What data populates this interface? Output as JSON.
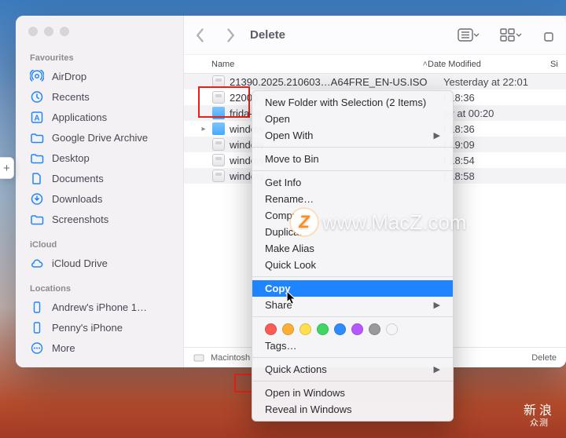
{
  "window_title": "Delete",
  "sidebar": {
    "groups": [
      {
        "header": "Favourites",
        "items": [
          {
            "name": "airdrop",
            "label": "AirDrop",
            "icon": "airdrop-icon"
          },
          {
            "name": "recents",
            "label": "Recents",
            "icon": "clock-icon"
          },
          {
            "name": "apps",
            "label": "Applications",
            "icon": "apps-icon"
          },
          {
            "name": "gdrive",
            "label": "Google Drive Archive",
            "icon": "folder-icon"
          },
          {
            "name": "desktop",
            "label": "Desktop",
            "icon": "folder-icon"
          },
          {
            "name": "docs",
            "label": "Documents",
            "icon": "doc-icon"
          },
          {
            "name": "dl",
            "label": "Downloads",
            "icon": "download-icon"
          },
          {
            "name": "shots",
            "label": "Screenshots",
            "icon": "folder-icon"
          }
        ]
      },
      {
        "header": "iCloud",
        "items": [
          {
            "name": "icloud",
            "label": "iCloud Drive",
            "icon": "cloud-icon"
          }
        ]
      },
      {
        "header": "Locations",
        "items": [
          {
            "name": "iphone1",
            "label": "Andrew's iPhone 1…",
            "icon": "device-icon"
          },
          {
            "name": "iphone2",
            "label": "Penny's iPhone",
            "icon": "device-icon"
          },
          {
            "name": "more",
            "label": "More",
            "icon": "more-icon",
            "dim": true
          }
        ]
      }
    ]
  },
  "columns": {
    "name": "Name",
    "date": "Date Modified",
    "size": "Si"
  },
  "files": [
    {
      "name": "21390.2025.210603…A64FRE_EN-US.ISO",
      "date": "Yesterday at 22:01",
      "icon": "disk",
      "disclose": ""
    },
    {
      "name": "22000.",
      "date": "t 18:36",
      "icon": "disk",
      "disclose": ""
    },
    {
      "name": "frida-io",
      "date": "ay at 00:20",
      "icon": "folder",
      "disclose": ""
    },
    {
      "name": "window",
      "date": "t 18:36",
      "icon": "folder",
      "disclose": "▸"
    },
    {
      "name": "window",
      "date": "t 19:09",
      "icon": "disk",
      "disclose": ""
    },
    {
      "name": "window",
      "date": "t 18:54",
      "icon": "disk",
      "disclose": ""
    },
    {
      "name": "window",
      "date": "t 18:58",
      "icon": "disk",
      "disclose": ""
    }
  ],
  "pathbar": {
    "disk": "Macintosh H",
    "folder": "Delete"
  },
  "context_menu": {
    "items": [
      {
        "type": "item",
        "label": "New Folder with Selection (2 Items)"
      },
      {
        "type": "item",
        "label": "Open"
      },
      {
        "type": "item",
        "label": "Open With",
        "submenu": true
      },
      {
        "type": "sep"
      },
      {
        "type": "item",
        "label": "Move to Bin"
      },
      {
        "type": "sep"
      },
      {
        "type": "item",
        "label": "Get Info"
      },
      {
        "type": "item",
        "label": "Rename…"
      },
      {
        "type": "item",
        "label": "Compre"
      },
      {
        "type": "item",
        "label": "Duplicate"
      },
      {
        "type": "item",
        "label": "Make Alias"
      },
      {
        "type": "item",
        "label": "Quick Look"
      },
      {
        "type": "sep"
      },
      {
        "type": "item",
        "label": "Copy",
        "highlight": true
      },
      {
        "type": "item",
        "label": "Share",
        "submenu": true
      },
      {
        "type": "sep"
      },
      {
        "type": "tags",
        "colors": [
          "#ff5b56",
          "#ffae35",
          "#ffe04b",
          "#3fd764",
          "#2f8cff",
          "#b757ff",
          "#9a9a9e",
          ""
        ]
      },
      {
        "type": "item",
        "label": "Tags…"
      },
      {
        "type": "sep"
      },
      {
        "type": "item",
        "label": "Quick Actions",
        "submenu": true
      },
      {
        "type": "sep"
      },
      {
        "type": "item",
        "label": "Open in Windows"
      },
      {
        "type": "item",
        "label": "Reveal in Windows"
      }
    ]
  },
  "watermark": {
    "logo": "Z",
    "text": "www.MacZ.com"
  },
  "corner_mark": {
    "top": "新浪",
    "bottom": "众测"
  }
}
